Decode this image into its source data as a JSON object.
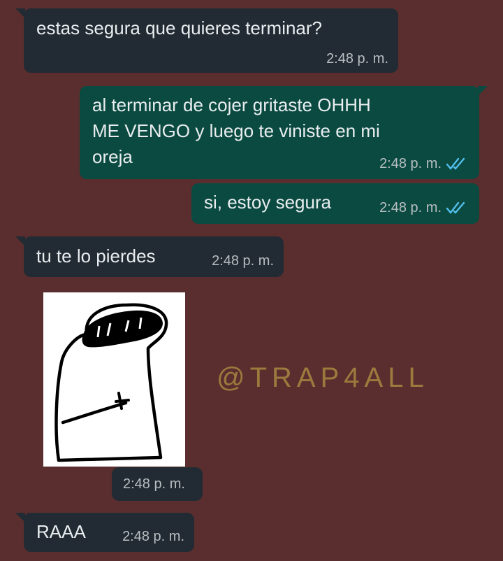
{
  "messages": [
    {
      "text": "estas segura que quieres terminar?",
      "time": "2:48 p. m."
    },
    {
      "text": "al terminar de cojer gritaste OHHH\nME VENGO y luego te viniste en mi\noreja",
      "time": "2:48 p. m."
    },
    {
      "text": "si, estoy segura",
      "time": "2:48 p. m."
    },
    {
      "text": "tu te lo pierdes",
      "time": "2:48 p. m."
    },
    {
      "time": "2:48 p. m."
    },
    {
      "text": "RAAA",
      "time": "2:48 p. m."
    }
  ],
  "watermark": "@TRAP4ALL",
  "colors": {
    "background": "#5a2e2e",
    "incoming_bubble": "#222b33",
    "outgoing_bubble": "#0a4a40",
    "read_ticks": "#53bdeb",
    "watermark": "#9b7a3e"
  },
  "icons": [
    "double-check-read-icon",
    "sticker-image"
  ]
}
